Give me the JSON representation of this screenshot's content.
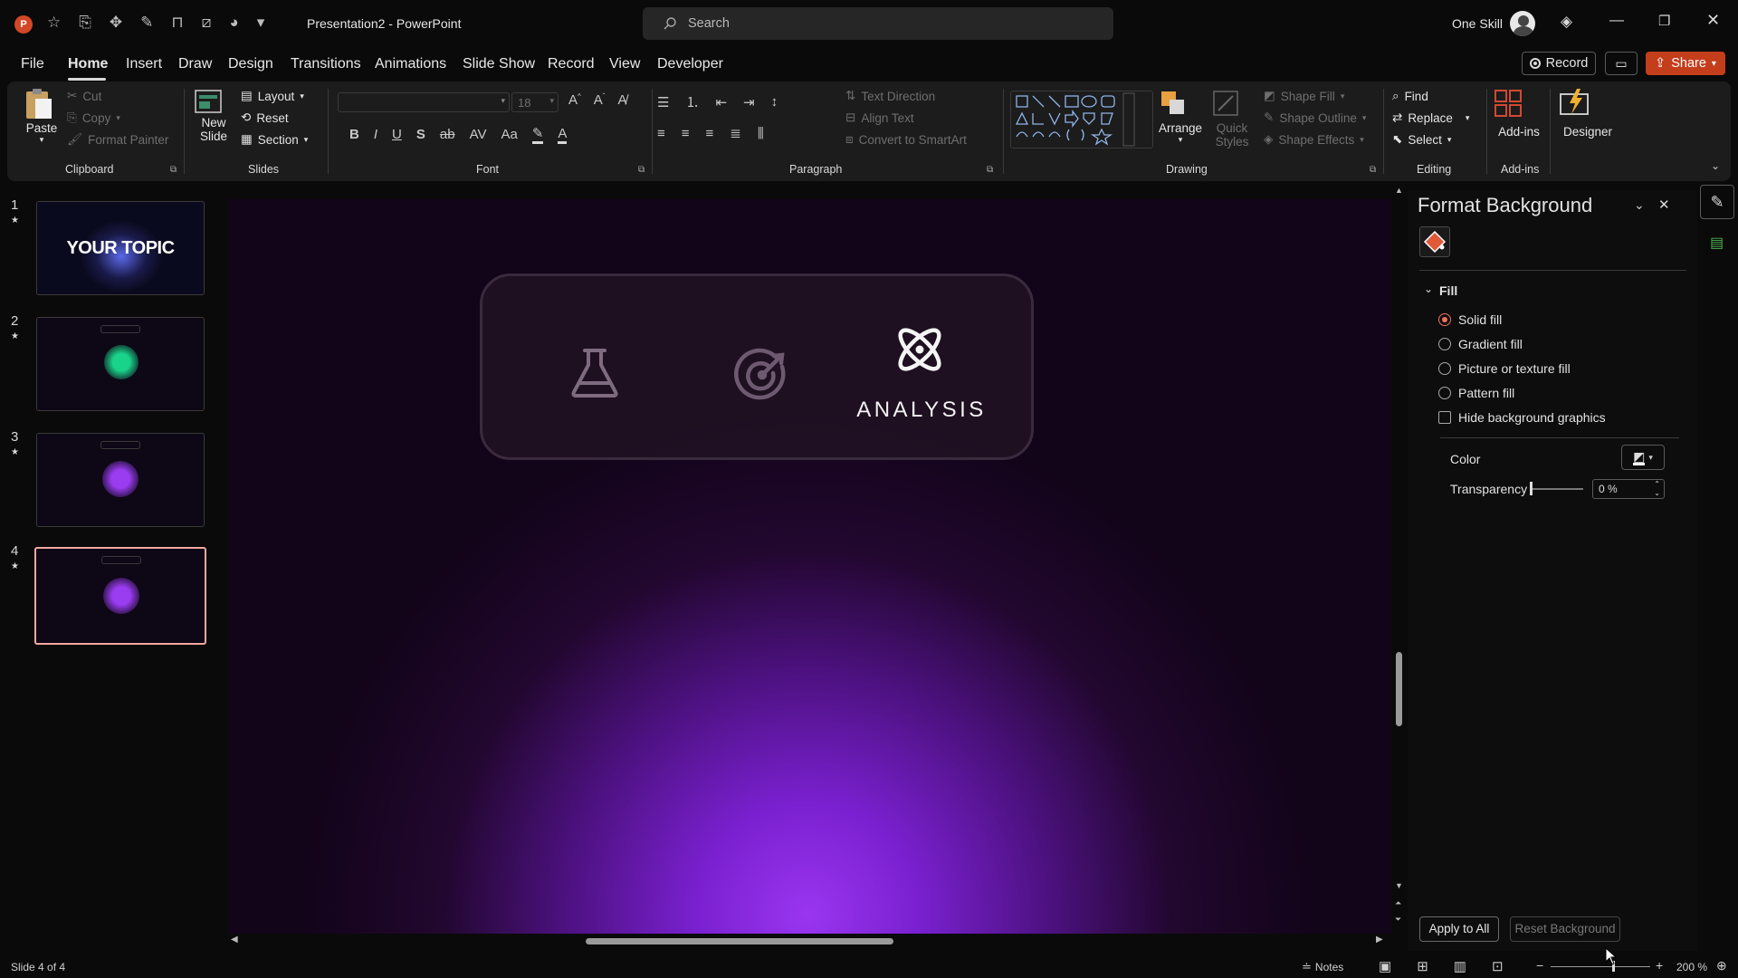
{
  "app": {
    "name": "PowerPoint",
    "document": "Presentation2",
    "separator": " - "
  },
  "titlebar": {
    "search_placeholder": "Search",
    "user_name": "One Skill",
    "qat_icons": [
      "powerpoint-logo-icon",
      "star-icon",
      "save-icon",
      "chevron-down-icon",
      "touch-mode-icon",
      "pen-icon",
      "presenter-icon",
      "crop-icon",
      "shape-icon",
      "more-icon"
    ]
  },
  "menu_tabs": [
    "File",
    "Home",
    "Insert",
    "Draw",
    "Design",
    "Transitions",
    "Animations",
    "Slide Show",
    "Record",
    "View",
    "Developer"
  ],
  "active_tab": "Home",
  "top_right": {
    "record_label": "Record",
    "share_label": "Share"
  },
  "ribbon": {
    "clipboard": {
      "paste": "Paste",
      "cut": "Cut",
      "copy": "Copy",
      "format_painter": "Format Painter",
      "group": "Clipboard"
    },
    "slides": {
      "new_slide_line1": "New",
      "new_slide_line2": "Slide",
      "layout": "Layout",
      "reset": "Reset",
      "section": "Section",
      "group": "Slides"
    },
    "font": {
      "size": "18",
      "group": "Font",
      "bold": "B",
      "italic": "I",
      "underline": "U",
      "shadow": "S",
      "strike": "ab",
      "spacing": "AV",
      "case": "Aa",
      "color": "A"
    },
    "paragraph": {
      "text_direction": "Text Direction",
      "align_text": "Align Text",
      "convert_smartart": "Convert to SmartArt",
      "group": "Paragraph"
    },
    "drawing": {
      "arrange": "Arrange",
      "quick_styles_1": "Quick",
      "quick_styles_2": "Styles",
      "shape_fill": "Shape Fill",
      "shape_outline": "Shape Outline",
      "shape_effects": "Shape Effects",
      "group": "Drawing"
    },
    "editing": {
      "find": "Find",
      "replace": "Replace",
      "select": "Select",
      "group": "Editing"
    },
    "addins": {
      "label": "Add-ins",
      "group": "Add-ins"
    },
    "designer": {
      "label": "Designer"
    }
  },
  "thumbnails": [
    {
      "num": "1",
      "star": "★",
      "title": "YOUR TOPIC",
      "glow": "#5a6ae8"
    },
    {
      "num": "2",
      "star": "★",
      "glow": "#19d38a"
    },
    {
      "num": "3",
      "star": "★",
      "glow": "#9a3cf0"
    },
    {
      "num": "4",
      "star": "★",
      "glow": "#9a3cf0"
    }
  ],
  "selected_slide": "4",
  "slide": {
    "label": "ANALYSIS",
    "icons": [
      "flask-icon",
      "target-icon",
      "atom-icon"
    ]
  },
  "format_background": {
    "title": "Format Background",
    "section": "Fill",
    "options": [
      "Solid fill",
      "Gradient fill",
      "Picture or texture fill",
      "Pattern fill"
    ],
    "selected_option": "Solid fill",
    "hide_graphics": "Hide background graphics",
    "color_label": "Color",
    "transparency_label": "Transparency",
    "transparency_value": "0 %",
    "apply_all": "Apply to All",
    "reset_bg": "Reset Background"
  },
  "status": {
    "slide_info": "Slide 4 of 4",
    "notes": "Notes",
    "zoom": "200 %"
  },
  "colors": {
    "accent": "#c43e1c",
    "selected_thumb_border": "#f0a8a0",
    "record_red": "#e04040",
    "share_bg": "#c43e1c"
  }
}
